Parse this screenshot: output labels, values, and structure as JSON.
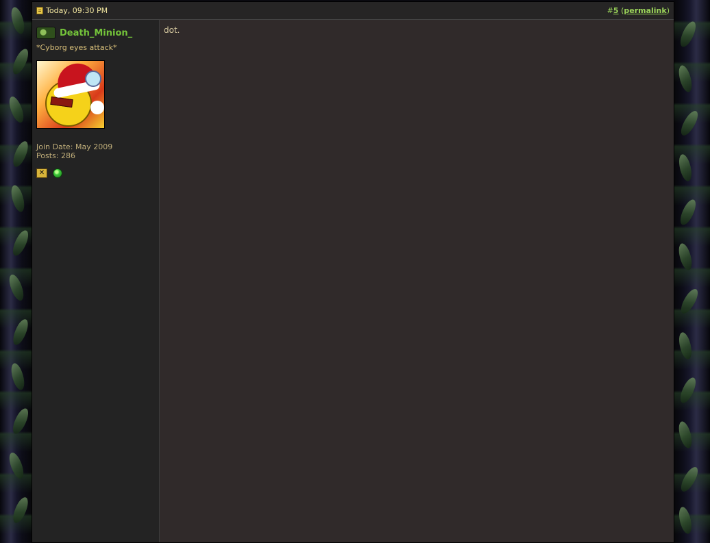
{
  "post": {
    "date": "Today, 09:30 PM",
    "number_prefix": "#",
    "number": "5",
    "permalink_open": "(",
    "permalink_label": "permalink",
    "permalink_close": ")"
  },
  "user": {
    "name": "Death_Minion_",
    "title": "*Cyborg eyes attack*",
    "join_date": "Join Date: May 2009",
    "posts": "Posts: 286"
  },
  "message": {
    "text": "dot."
  },
  "icons": {
    "post_icon": "post-icon",
    "user_badge": "user-badge-icon",
    "offline": "offline-status-icon",
    "reputation": "reputation-icon"
  },
  "colors": {
    "username": "#74c43a",
    "header_text": "#f3e7a0",
    "permalink": "#9bd45a",
    "content_bg": "#302a2a"
  }
}
